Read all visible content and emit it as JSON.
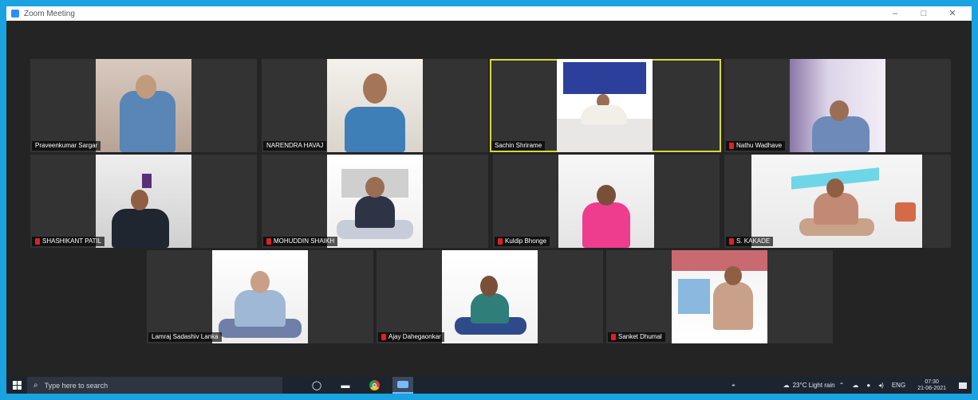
{
  "window": {
    "title": "Zoom Meeting",
    "controls": [
      "–",
      "□",
      "✕"
    ]
  },
  "participants": [
    {
      "name": "Praveenkumar Sargar",
      "muted": false
    },
    {
      "name": "NARENDRA HAVAJ",
      "muted": false
    },
    {
      "name": "Sachin Shrirame",
      "muted": false,
      "active_speaker": true
    },
    {
      "name": "Nathu Wadhave",
      "muted": true
    },
    {
      "name": "SHASHIKANT PATIL",
      "muted": true
    },
    {
      "name": "MOHUDDIN SHAIKH",
      "muted": true
    },
    {
      "name": "Kuldip Bhonge",
      "muted": true
    },
    {
      "name": "S. KAKADE",
      "muted": true
    },
    {
      "name": "Lamraj Sadashiv Lanka",
      "muted": false
    },
    {
      "name": "Ajay Dahegaonkar",
      "muted": true
    },
    {
      "name": "Sanket Dhumal",
      "muted": true
    }
  ],
  "taskbar": {
    "search_placeholder": "Type here to search",
    "weather": "23°C  Light rain",
    "language": "ENG",
    "time": "07:30",
    "date": "21-06-2021"
  },
  "colors": {
    "border": "#1aa3e0",
    "active_speaker": "#d8d83a",
    "muted": "#e02020"
  }
}
